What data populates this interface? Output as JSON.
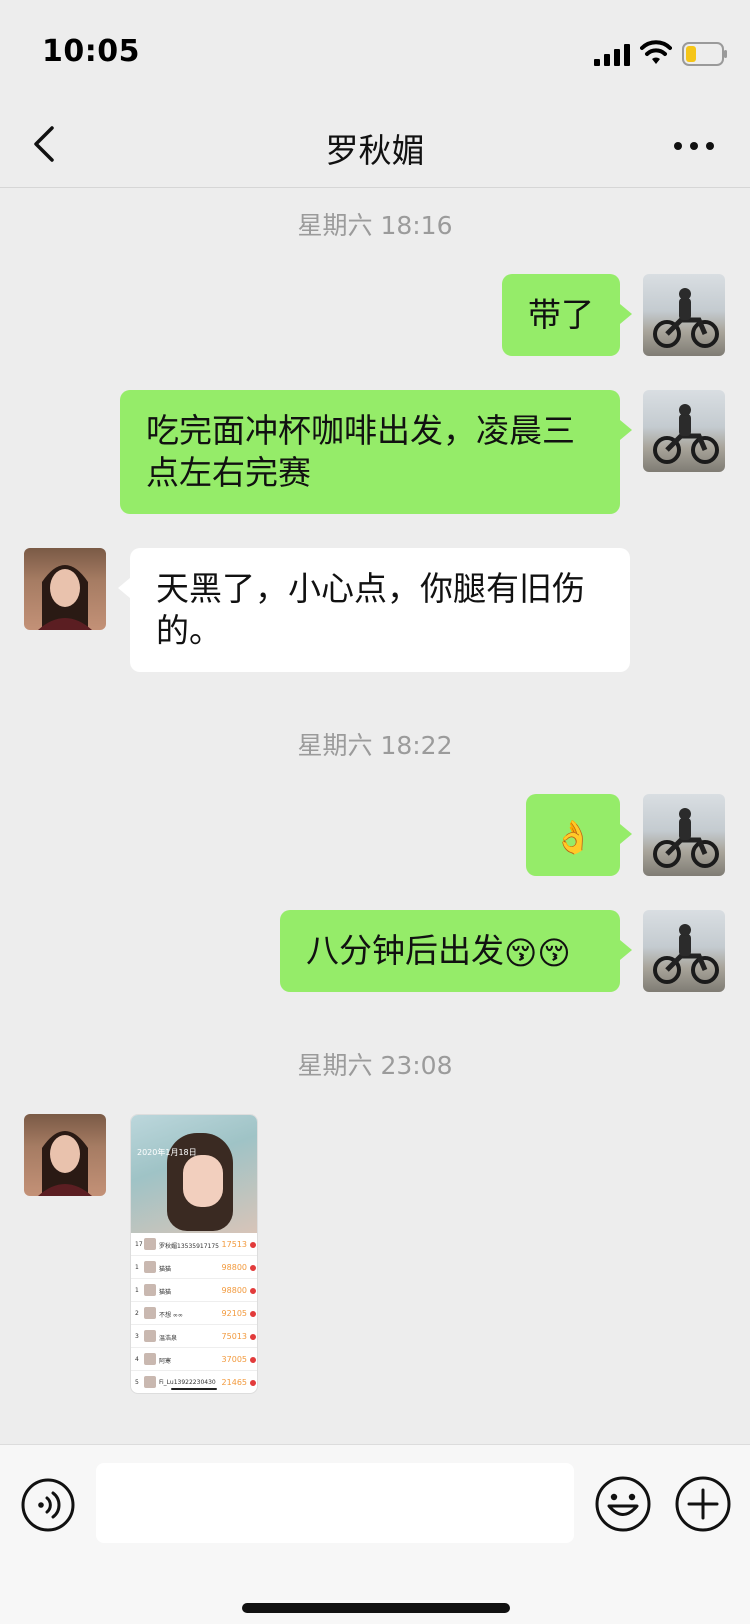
{
  "status_bar": {
    "time": "10:05"
  },
  "header": {
    "title": "罗秋媚"
  },
  "messages": {
    "t1": "星期六 18:16",
    "m1": "带了",
    "m2": "吃完面冲杯咖啡出发，凌晨三点左右完赛",
    "m3": "天黑了，小心点，你腿有旧伤的。",
    "t2": "星期六 18:22",
    "m4": "👌",
    "m5_text": "八分钟后出发",
    "m5_emoji": "😚😚",
    "t3": "星期六 23:08"
  },
  "image_message": {
    "date": "2020年1月18日",
    "rows": [
      {
        "rank": "17",
        "name": "罗秋媚13535917175",
        "score": "17513"
      },
      {
        "rank": "1",
        "name": "猫猫",
        "score": "98800"
      },
      {
        "rank": "1",
        "name": "猫猫",
        "score": "98800"
      },
      {
        "rank": "2",
        "name": "不想 ∞∞",
        "score": "92105"
      },
      {
        "rank": "3",
        "name": "温浩泉",
        "score": "75013"
      },
      {
        "rank": "4",
        "name": "阿寒",
        "score": "37005"
      },
      {
        "rank": "5",
        "name": "Fi_Lu13922230430",
        "score": "21465"
      }
    ]
  },
  "input": {
    "placeholder": ""
  },
  "icons": {
    "back": "chevron-left-icon",
    "more": "more-icon",
    "voice": "voice-icon",
    "emoji": "emoji-icon",
    "plus": "plus-icon"
  },
  "colors": {
    "my_bubble": "#95ec69",
    "other_bubble": "#ffffff",
    "background": "#ededed"
  }
}
